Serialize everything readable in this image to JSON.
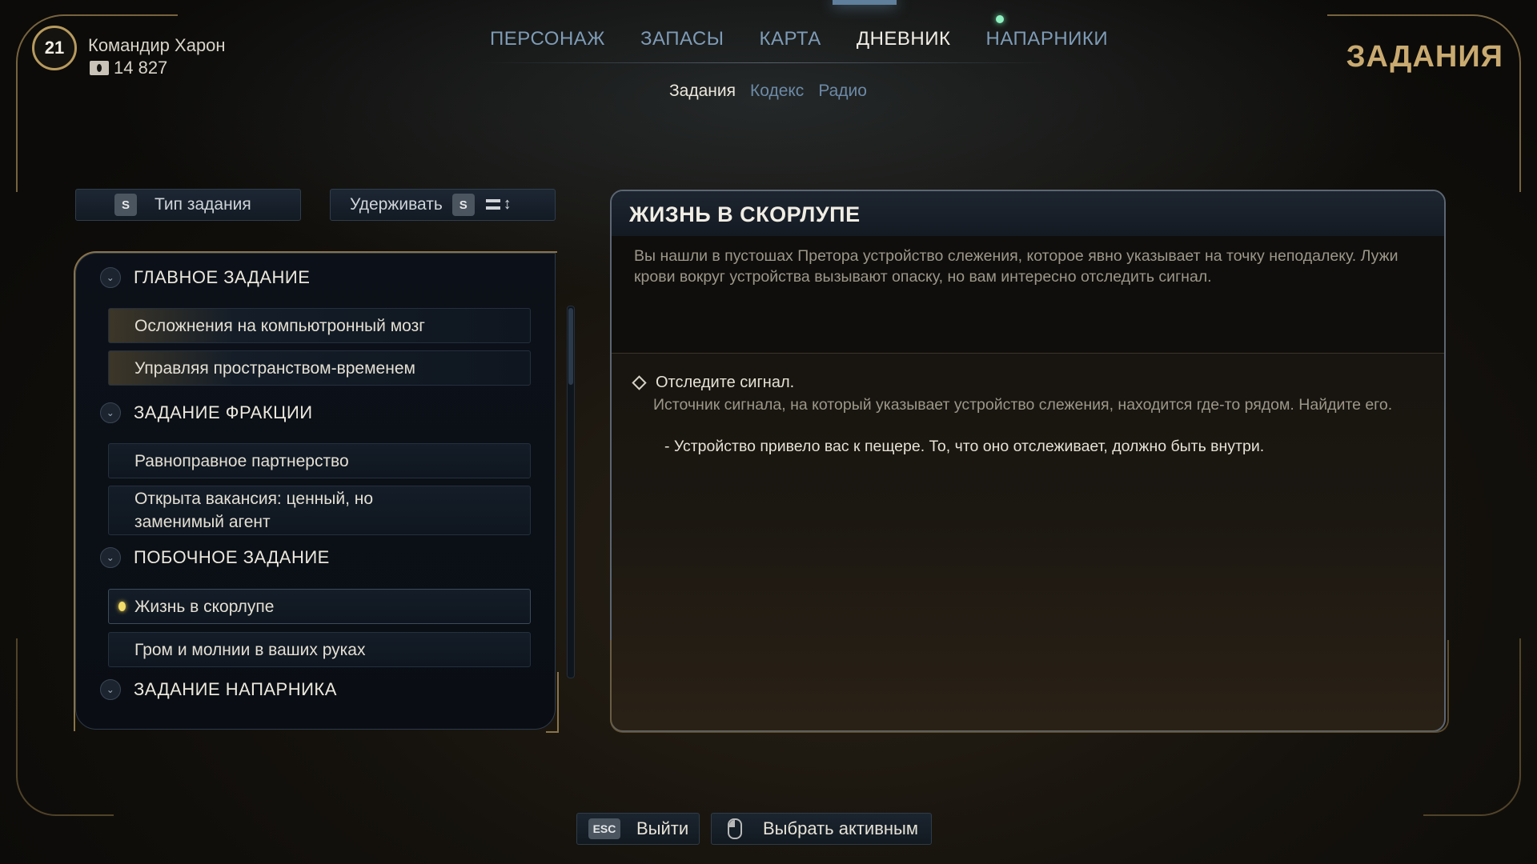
{
  "player": {
    "level": "21",
    "name": "Командир Харон",
    "money": "14 827"
  },
  "nav": {
    "tabs": [
      {
        "label": "ПЕРСОНАЖ",
        "active": false
      },
      {
        "label": "ЗАПАСЫ",
        "active": false
      },
      {
        "label": "КАРТА",
        "active": false
      },
      {
        "label": "ДНЕВНИК",
        "active": true
      },
      {
        "label": "НАПАРНИКИ",
        "active": false
      }
    ],
    "subtabs": [
      {
        "label": "Задания",
        "active": true
      },
      {
        "label": "Кодекс",
        "active": false
      },
      {
        "label": "Радио",
        "active": false
      }
    ],
    "page_title": "ЗАДАНИЯ"
  },
  "filters": {
    "type_key": "S",
    "type_label": "Тип задания",
    "hold_label": "Удерживать",
    "hold_key": "S"
  },
  "quests": {
    "categories": [
      {
        "title": "ГЛАВНОЕ ЗАДАНИЕ",
        "items": [
          "Осложнения на компьютронный мозг",
          "Управляя пространством-временем"
        ]
      },
      {
        "title": "ЗАДАНИЕ ФРАКЦИИ",
        "items": [
          "Равноправное партнерство",
          "Открыта вакансия: ценный, но заменимый агент"
        ]
      },
      {
        "title": "ПОБОЧНОЕ ЗАДАНИЕ",
        "items": [
          "Жизнь в скорлупе",
          "Гром и молнии в ваших руках"
        ]
      },
      {
        "title": "ЗАДАНИЕ НАПАРНИКА",
        "items": []
      }
    ]
  },
  "detail": {
    "title": "ЖИЗНЬ В СКОРЛУПЕ",
    "description": "Вы нашли в пустошах Претора устройство слежения, которое явно указывает на точку неподалеку. Лужи крови вокруг устройства вызывают опаску, но вам интересно отследить сигнал.",
    "objective": "Отследите сигнал.",
    "objective_desc": "Источник сигнала, на который указывает устройство слежения, находится где-то рядом. Найдите его.",
    "objective_note": "- Устройство привело вас к пещере. То, что оно отслеживает, должно быть внутри."
  },
  "actions": {
    "exit_key": "ESC",
    "exit_label": "Выйти",
    "select_label": "Выбрать активным"
  },
  "colors": {
    "accent_gold": "#c9aa70",
    "nav_blue": "#7e9bb6",
    "active_marker": "#f3dc6a"
  }
}
